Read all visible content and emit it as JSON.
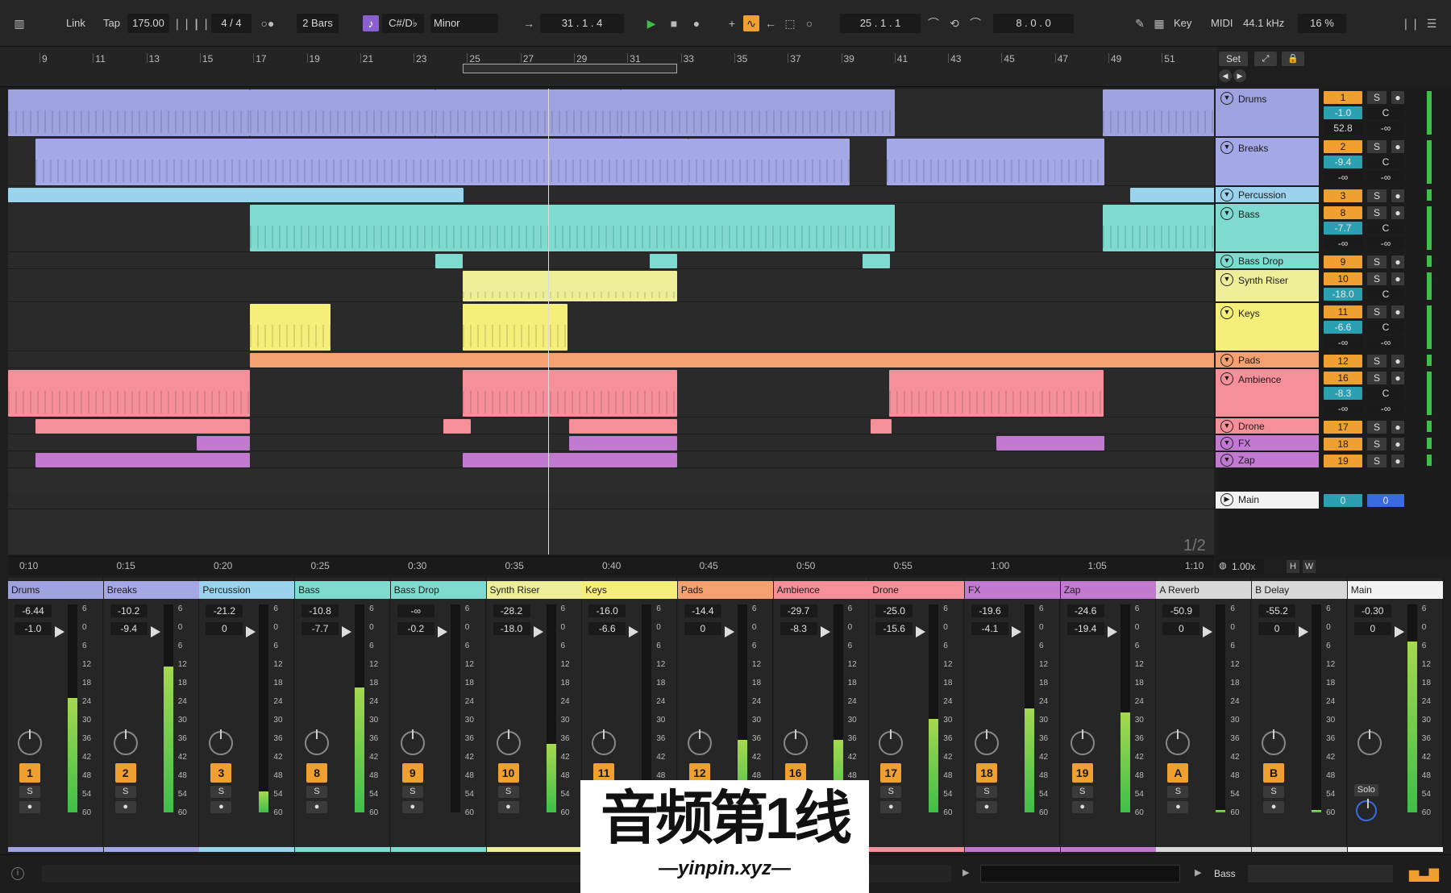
{
  "transport": {
    "link": "Link",
    "tap": "Tap",
    "tempo": "175.00",
    "time_sig": "4 / 4",
    "quantize": "2 Bars",
    "key": "C#/D♭",
    "scale": "Minor",
    "position": "31 .  1 .  4",
    "loop_start": "25 .  1 .  1",
    "loop_length": "8 .  0 .  0",
    "key_btn": "Key",
    "midi_btn": "MIDI",
    "sample_rate": "44.1 kHz",
    "cpu": "16 %"
  },
  "ruler_bars": [
    "9",
    "11",
    "13",
    "15",
    "17",
    "19",
    "21",
    "23",
    "25",
    "27",
    "29",
    "31",
    "33",
    "35",
    "37",
    "39",
    "41",
    "43",
    "45",
    "47",
    "49",
    "51"
  ],
  "time_ticks": [
    "0:10",
    "0:15",
    "0:20",
    "0:25",
    "0:30",
    "0:35",
    "0:40",
    "0:45",
    "0:50",
    "0:55",
    "1:00",
    "1:05",
    "1:10"
  ],
  "set_btn": "Set",
  "page_label": "1/2",
  "zoom": "1.00x",
  "view_h": "H",
  "view_w": "W",
  "tracks": [
    {
      "name": "Drums",
      "num": "1",
      "vol": "-1.0",
      "pan": "C",
      "extra1": "52.8",
      "extra2": "-∞"
    },
    {
      "name": "Breaks",
      "num": "2",
      "vol": "-9.4",
      "pan": "C",
      "extra1": "-∞",
      "extra2": "-∞"
    },
    {
      "name": "Percussion",
      "num": "3"
    },
    {
      "name": "Bass",
      "num": "8",
      "vol": "-7.7",
      "pan": "C",
      "extra1": "-∞",
      "extra2": "-∞"
    },
    {
      "name": "Bass Drop",
      "num": "9"
    },
    {
      "name": "Synth Riser",
      "num": "10",
      "vol": "-18.0",
      "pan": "C"
    },
    {
      "name": "Keys",
      "num": "11",
      "vol": "-6.6",
      "pan": "C",
      "extra1": "-∞",
      "extra2": "-∞"
    },
    {
      "name": "Pads",
      "num": "12"
    },
    {
      "name": "Ambience",
      "num": "16",
      "vol": "-8.3",
      "pan": "C",
      "extra1": "-∞",
      "extra2": "-∞"
    },
    {
      "name": "Drone",
      "num": "17"
    },
    {
      "name": "FX",
      "num": "18"
    },
    {
      "name": "Zap",
      "num": "19"
    }
  ],
  "main_track": {
    "name": "Main",
    "val1": "0",
    "val2": "0"
  },
  "solo_label": "S",
  "pan_label": "C",
  "mixer": [
    {
      "name": "Drums",
      "peak": "-6.44",
      "vol": "-1.0",
      "num": "1"
    },
    {
      "name": "Breaks",
      "peak": "-10.2",
      "vol": "-9.4",
      "num": "2"
    },
    {
      "name": "Percussion",
      "peak": "-21.2",
      "vol": "0",
      "num": "3"
    },
    {
      "name": "Bass",
      "peak": "-10.8",
      "vol": "-7.7",
      "num": "8"
    },
    {
      "name": "Bass Drop",
      "peak": "-∞",
      "vol": "-0.2",
      "num": "9"
    },
    {
      "name": "Synth Riser",
      "peak": "-28.2",
      "vol": "-18.0",
      "num": "10"
    },
    {
      "name": "Keys",
      "peak": "-16.0",
      "vol": "-6.6",
      "num": "11"
    },
    {
      "name": "Pads",
      "peak": "-14.4",
      "vol": "0",
      "num": "12"
    },
    {
      "name": "Ambience",
      "peak": "-29.7",
      "vol": "-8.3",
      "num": "16"
    },
    {
      "name": "Drone",
      "peak": "-25.0",
      "vol": "-15.6",
      "num": "17"
    },
    {
      "name": "FX",
      "peak": "-19.6",
      "vol": "-4.1",
      "num": "18"
    },
    {
      "name": "Zap",
      "peak": "-24.6",
      "vol": "-19.4",
      "num": "19"
    },
    {
      "name": "A Reverb",
      "peak": "-50.9",
      "vol": "0",
      "num": "A"
    },
    {
      "name": "B Delay",
      "peak": "-55.2",
      "vol": "0",
      "num": "B"
    },
    {
      "name": "Main",
      "peak": "-0.30",
      "vol": "0",
      "num": ""
    }
  ],
  "main_solo": "Solo",
  "meter_scale": [
    "6",
    "0",
    "6",
    "12",
    "18",
    "24",
    "30",
    "36",
    "42",
    "48",
    "54",
    "60"
  ],
  "status": {
    "track": "Bass"
  },
  "watermark": {
    "line1": "音频第1线",
    "line2": "—yinpin.xyz—"
  }
}
